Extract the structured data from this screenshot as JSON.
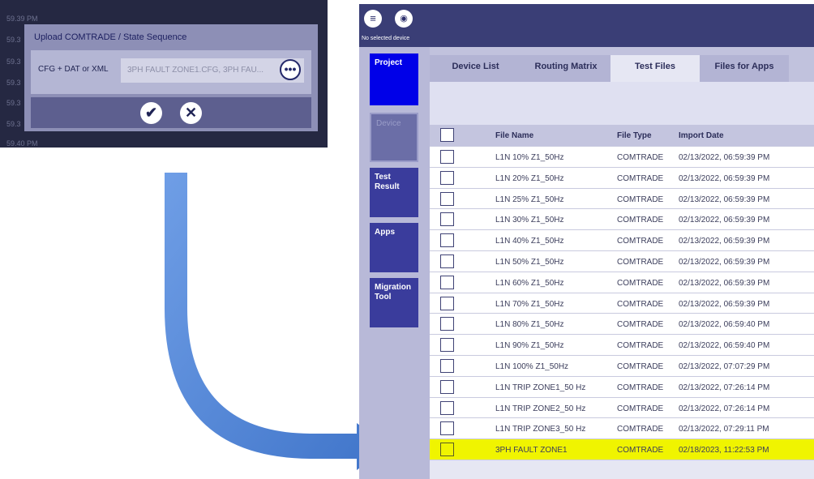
{
  "background_times": [
    "59.39 PM",
    "59.3",
    "59.3",
    "59.3",
    "59.3",
    "59.3",
    "59.40 PM"
  ],
  "upload_dialog": {
    "title": "Upload COMTRADE / State Sequence",
    "field_label": "CFG + DAT or XML",
    "field_value": "3PH FAULT ZONE1.CFG, 3PH FAU...",
    "more_glyph": "•••",
    "confirm_glyph": "✔",
    "cancel_glyph": "✕"
  },
  "app": {
    "status_text": "No selected device",
    "icons": {
      "menu": "menu-icon",
      "device": "device-icon"
    },
    "sidebar": [
      {
        "label": "Project"
      },
      {
        "label": "Device"
      },
      {
        "label": "Test Result"
      },
      {
        "label": "Apps"
      },
      {
        "label": "Migration Tool"
      }
    ],
    "tabs": [
      {
        "label": "Device List"
      },
      {
        "label": "Routing Matrix"
      },
      {
        "label": "Test Files",
        "active": true
      },
      {
        "label": "Files for Apps"
      }
    ],
    "table": {
      "headers": {
        "name": "File Name",
        "type": "File Type",
        "date": "Import Date"
      },
      "rows": [
        {
          "name": "L1N 10% Z1_50Hz",
          "type": "COMTRADE",
          "date": "02/13/2022, 06:59:39 PM"
        },
        {
          "name": "L1N 20% Z1_50Hz",
          "type": "COMTRADE",
          "date": "02/13/2022, 06:59:39 PM"
        },
        {
          "name": "L1N 25% Z1_50Hz",
          "type": "COMTRADE",
          "date": "02/13/2022, 06:59:39 PM"
        },
        {
          "name": "L1N 30% Z1_50Hz",
          "type": "COMTRADE",
          "date": "02/13/2022, 06:59:39 PM"
        },
        {
          "name": "L1N 40% Z1_50Hz",
          "type": "COMTRADE",
          "date": "02/13/2022, 06:59:39 PM"
        },
        {
          "name": "L1N 50% Z1_50Hz",
          "type": "COMTRADE",
          "date": "02/13/2022, 06:59:39 PM"
        },
        {
          "name": "L1N 60% Z1_50Hz",
          "type": "COMTRADE",
          "date": "02/13/2022, 06:59:39 PM"
        },
        {
          "name": "L1N 70% Z1_50Hz",
          "type": "COMTRADE",
          "date": "02/13/2022, 06:59:39 PM"
        },
        {
          "name": "L1N 80% Z1_50Hz",
          "type": "COMTRADE",
          "date": "02/13/2022, 06:59:40 PM"
        },
        {
          "name": "L1N 90% Z1_50Hz",
          "type": "COMTRADE",
          "date": "02/13/2022, 06:59:40 PM"
        },
        {
          "name": "L1N 100% Z1_50Hz",
          "type": "COMTRADE",
          "date": "02/13/2022, 07:07:29 PM"
        },
        {
          "name": "L1N TRIP ZONE1_50 Hz",
          "type": "COMTRADE",
          "date": "02/13/2022, 07:26:14 PM"
        },
        {
          "name": "L1N TRIP ZONE2_50 Hz",
          "type": "COMTRADE",
          "date": "02/13/2022, 07:26:14 PM"
        },
        {
          "name": "L1N TRIP ZONE3_50 Hz",
          "type": "COMTRADE",
          "date": "02/13/2022, 07:29:11 PM"
        },
        {
          "name": "3PH FAULT ZONE1",
          "type": "COMTRADE",
          "date": "02/18/2023, 11:22:53 PM",
          "highlighted": true
        }
      ]
    }
  },
  "colors": {
    "highlight": "#f0f400",
    "arrow": "#4a7fd1",
    "project_blue": "#0000e8",
    "sidebar_button": "#3a3c9c"
  }
}
